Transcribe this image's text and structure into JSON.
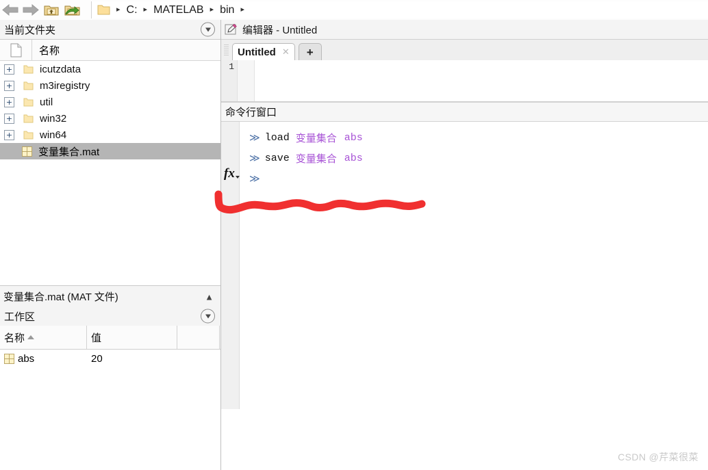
{
  "toolbar": {
    "back_icon": "back-arrow-icon",
    "forward_icon": "forward-arrow-icon",
    "up_folder_icon": "up-folder-icon",
    "browse_folder_icon": "browse-folder-icon",
    "breadcrumb": {
      "folder_icon": "folder-icon",
      "items": [
        "C:",
        "MATELAB",
        "bin"
      ],
      "separator": "▸"
    }
  },
  "current_folder_panel": {
    "title": "当前文件夹",
    "dropdown_icon": "dropdown-circle-icon",
    "column_header": {
      "icon": "document-icon",
      "name": "名称"
    },
    "rows": [
      {
        "label": "icutzdata",
        "icon": "folder-icon",
        "expander": "+",
        "type": "folder",
        "selected": false
      },
      {
        "label": "m3iregistry",
        "icon": "folder-icon",
        "expander": "+",
        "type": "folder",
        "selected": false
      },
      {
        "label": "util",
        "icon": "folder-icon",
        "expander": "+",
        "type": "folder",
        "selected": false
      },
      {
        "label": "win32",
        "icon": "folder-icon",
        "expander": "+",
        "type": "folder",
        "selected": false
      },
      {
        "label": "win64",
        "icon": "folder-icon",
        "expander": "+",
        "type": "folder",
        "selected": false
      },
      {
        "label": "变量集合.mat",
        "icon": "mat-file-icon",
        "expander": "",
        "type": "file",
        "selected": true
      }
    ]
  },
  "file_info_bar": {
    "text": "变量集合.mat  (MAT 文件)",
    "collapse_icon": "chevron-up-icon"
  },
  "workspace_panel": {
    "title": "工作区",
    "dropdown_icon": "dropdown-circle-icon",
    "columns": [
      "名称",
      "值",
      ""
    ],
    "sort_indicator": "ascending",
    "rows": [
      {
        "icon": "mat-variable-icon",
        "name": "abs",
        "value": "20"
      }
    ]
  },
  "editor_panel": {
    "icon": "editor-pencil-icon",
    "title": "编辑器 - Untitled",
    "grip_icon": "drag-grip-icon",
    "tabs": [
      {
        "label": "Untitled",
        "close_icon": "close-icon",
        "active": true
      }
    ],
    "new_tab_label": "+",
    "line_numbers": [
      "1"
    ],
    "content": ""
  },
  "command_window": {
    "title": "命令行窗口",
    "fx_icon": "fx-function-icon",
    "fx_dropdown_icon": "caret-down-icon",
    "prompt": "≫",
    "lines": [
      {
        "prompt": "≫",
        "command": "load",
        "arg1": "变量集合",
        "arg2": "abs"
      },
      {
        "prompt": "≫",
        "command": "save",
        "arg1": "变量集合",
        "arg2": "abs"
      },
      {
        "prompt": "≫",
        "command": "",
        "arg1": "",
        "arg2": ""
      }
    ]
  },
  "annotation": {
    "type": "red-scribble-underline",
    "color": "#f03030"
  },
  "watermark": {
    "text": "CSDN @芹菜很菜"
  }
}
